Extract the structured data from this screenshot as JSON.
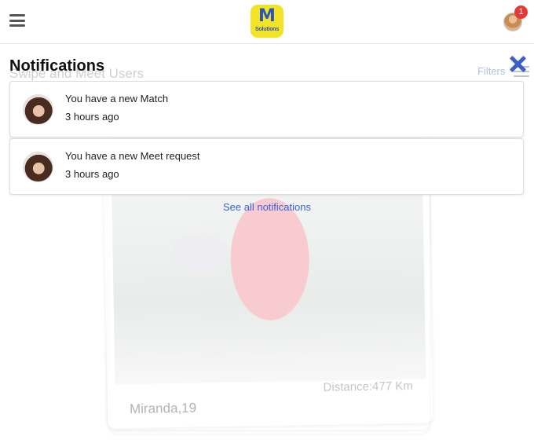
{
  "header": {
    "menu_icon": "hamburger-icon",
    "logo": {
      "letter": "M",
      "sub": "Solutions",
      "bg_color": "#f2e325",
      "fg_color": "#2b54b8"
    },
    "notification_count": "1",
    "badge_color": "#e53935"
  },
  "background": {
    "page_title": "Swipe and Meet Users",
    "filters_label": "Filters",
    "card": {
      "name": "Miranda,19",
      "distance": "Distance:477 Km"
    }
  },
  "notifications": {
    "title": "Notifications",
    "close_icon": "close-icon",
    "accent_color": "#3b5fc9",
    "items": [
      {
        "text": "You have a new Match",
        "time": "3 hours ago"
      },
      {
        "text": "You have a new Meet request",
        "time": "3 hours ago"
      }
    ],
    "see_all_label": "See all notifications"
  }
}
